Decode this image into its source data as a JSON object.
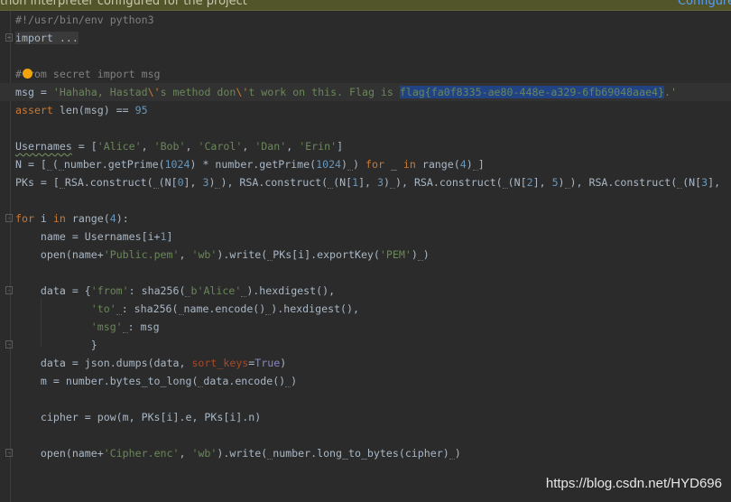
{
  "banner": {
    "message": "thon interpreter configured for the project",
    "link": "Configure"
  },
  "watermark": "https://blog.csdn.net/HYD696",
  "colors": {
    "background": "#2b2b2b",
    "keyword": "#cc7832",
    "string": "#6a8759",
    "number": "#6897bb",
    "comment": "#808080",
    "selection": "#214283",
    "banner": "#52542a"
  },
  "icons": {
    "bulb": "intention-bulb-icon",
    "fold": "fold-icon"
  },
  "code": [
    {
      "fold": false,
      "tokens": [
        [
          "#!/usr/bin/env python3",
          "cm"
        ]
      ]
    },
    {
      "fold": true,
      "fold_sign": "+",
      "tokens": [
        [
          "import ...",
          "fold"
        ]
      ]
    },
    {
      "tokens": []
    },
    {
      "tokens": [
        [
          "#from secret import msg",
          "cm"
        ]
      ]
    },
    {
      "current": true,
      "tokens": [
        [
          "msg = ",
          ""
        ],
        [
          "'",
          "str"
        ],
        [
          "Hahaha",
          "str"
        ],
        [
          ", ",
          "str"
        ],
        [
          "Hastad",
          "str"
        ],
        [
          "\\'",
          "kw"
        ],
        [
          "s method don",
          "str"
        ],
        [
          "\\'",
          "kw"
        ],
        [
          "t work on this. Flag is ",
          "str"
        ],
        [
          "flag{fa0f8335-ae80-448e-a329-6fb69048aae4}",
          "strsel"
        ],
        [
          ".'",
          "str"
        ]
      ]
    },
    {
      "tokens": [
        [
          "assert",
          "kw"
        ],
        [
          " len(msg) == ",
          ""
        ],
        [
          "95",
          "num"
        ]
      ]
    },
    {
      "tokens": []
    },
    {
      "tokens": [
        [
          "Usernames",
          "warn"
        ],
        [
          " = [",
          ""
        ],
        [
          "'Alice'",
          "str"
        ],
        [
          ", ",
          ""
        ],
        [
          "'Bob'",
          "str"
        ],
        [
          ", ",
          ""
        ],
        [
          "'Carol'",
          "str"
        ],
        [
          ", ",
          ""
        ],
        [
          "'Dan'",
          "str"
        ],
        [
          ", ",
          ""
        ],
        [
          "'Erin'",
          "str"
        ],
        [
          "]",
          ""
        ]
      ]
    },
    {
      "tokens": [
        [
          "N = [",
          ""
        ],
        [
          "",
          "hint"
        ],
        [
          "(",
          ""
        ],
        [
          "",
          "hint"
        ],
        [
          "number.getPrime(",
          ""
        ],
        [
          "1024",
          "num"
        ],
        [
          ") * number.getPrime(",
          ""
        ],
        [
          "1024",
          "num"
        ],
        [
          ")",
          ""
        ],
        [
          "",
          "hint"
        ],
        [
          ") ",
          ""
        ],
        [
          "for",
          "kw"
        ],
        [
          " _ ",
          ""
        ],
        [
          "in",
          "kw"
        ],
        [
          " range(",
          ""
        ],
        [
          "4",
          "num"
        ],
        [
          ")",
          ""
        ],
        [
          "",
          "hint"
        ],
        [
          "]",
          ""
        ]
      ]
    },
    {
      "tokens": [
        [
          "PKs = [",
          ""
        ],
        [
          "",
          "hint"
        ],
        [
          "RSA.construct(",
          ""
        ],
        [
          "",
          "hint"
        ],
        [
          "(N[",
          ""
        ],
        [
          "0",
          "num"
        ],
        [
          "], ",
          ""
        ],
        [
          "3",
          "num"
        ],
        [
          ")",
          ""
        ],
        [
          "",
          "hint"
        ],
        [
          "), RSA.construct(",
          ""
        ],
        [
          "",
          "hint"
        ],
        [
          "(N[",
          ""
        ],
        [
          "1",
          "num"
        ],
        [
          "], ",
          ""
        ],
        [
          "3",
          "num"
        ],
        [
          ")",
          ""
        ],
        [
          "",
          "hint"
        ],
        [
          "), RSA.construct(",
          ""
        ],
        [
          "",
          "hint"
        ],
        [
          "(N[",
          ""
        ],
        [
          "2",
          "num"
        ],
        [
          "], ",
          ""
        ],
        [
          "5",
          "num"
        ],
        [
          ")",
          ""
        ],
        [
          "",
          "hint"
        ],
        [
          "), RSA.construct(",
          ""
        ],
        [
          "",
          "hint"
        ],
        [
          "(N[",
          ""
        ],
        [
          "3",
          "num"
        ],
        [
          "],",
          ""
        ]
      ]
    },
    {
      "tokens": []
    },
    {
      "fold": true,
      "fold_sign": "-",
      "tokens": [
        [
          "for",
          "kw"
        ],
        [
          " i ",
          ""
        ],
        [
          "in",
          "kw"
        ],
        [
          " range(",
          ""
        ],
        [
          "4",
          "num"
        ],
        [
          "):",
          ""
        ]
      ]
    },
    {
      "tokens": [
        [
          "    name = Usernames[i+",
          ""
        ],
        [
          "1",
          "num"
        ],
        [
          "]",
          ""
        ]
      ]
    },
    {
      "tokens": [
        [
          "    open(name+",
          ""
        ],
        [
          "'Public.pem'",
          "str"
        ],
        [
          ", ",
          ""
        ],
        [
          "'wb'",
          "str"
        ],
        [
          ").write(",
          ""
        ],
        [
          "",
          "hint"
        ],
        [
          "PKs[i].exportKey(",
          ""
        ],
        [
          "'PEM'",
          "str"
        ],
        [
          ")",
          ""
        ],
        [
          "",
          "hint"
        ],
        [
          ")",
          ""
        ]
      ]
    },
    {
      "tokens": []
    },
    {
      "fold": true,
      "fold_sign": "-",
      "tokens": [
        [
          "    data = {",
          ""
        ],
        [
          "'from'",
          "str"
        ],
        [
          ": sha256(",
          ""
        ],
        [
          "",
          "hint"
        ],
        [
          "b'Alice'",
          "str"
        ],
        [
          "",
          "hint"
        ],
        [
          ").hexdigest(),",
          ""
        ]
      ]
    },
    {
      "tokens": [
        [
          "            ",
          ""
        ],
        [
          "'to'",
          "str"
        ],
        [
          "",
          "hint"
        ],
        [
          ": sha256(",
          ""
        ],
        [
          "",
          "hint"
        ],
        [
          "name.encode()",
          ""
        ],
        [
          "",
          "hint"
        ],
        [
          ").hexdigest(),",
          ""
        ]
      ]
    },
    {
      "tokens": [
        [
          "            ",
          ""
        ],
        [
          "'msg'",
          "str"
        ],
        [
          "",
          "hint"
        ],
        [
          ": msg",
          ""
        ]
      ]
    },
    {
      "fold": true,
      "fold_sign": "-",
      "tokens": [
        [
          "            }",
          ""
        ]
      ]
    },
    {
      "tokens": [
        [
          "    data = json.dumps(data, ",
          ""
        ],
        [
          "sort_keys",
          "param"
        ],
        [
          "=",
          ""
        ],
        [
          "True",
          "const"
        ],
        [
          ")",
          ""
        ]
      ]
    },
    {
      "tokens": [
        [
          "    m = number.bytes_to_long(",
          ""
        ],
        [
          "",
          "hint"
        ],
        [
          "data.encode()",
          ""
        ],
        [
          "",
          "hint"
        ],
        [
          ")",
          ""
        ]
      ]
    },
    {
      "tokens": []
    },
    {
      "tokens": [
        [
          "    cipher = pow(m, PKs[i].e, PKs[i].n)",
          ""
        ]
      ]
    },
    {
      "tokens": []
    },
    {
      "fold": true,
      "fold_sign": "-",
      "tokens": [
        [
          "    open(name+",
          ""
        ],
        [
          "'Cipher.enc'",
          "str"
        ],
        [
          ", ",
          ""
        ],
        [
          "'wb'",
          "str"
        ],
        [
          ").write(",
          ""
        ],
        [
          "",
          "hint"
        ],
        [
          "number.long_to_bytes(cipher)",
          ""
        ],
        [
          "",
          "hint"
        ],
        [
          ")",
          ""
        ]
      ]
    }
  ]
}
